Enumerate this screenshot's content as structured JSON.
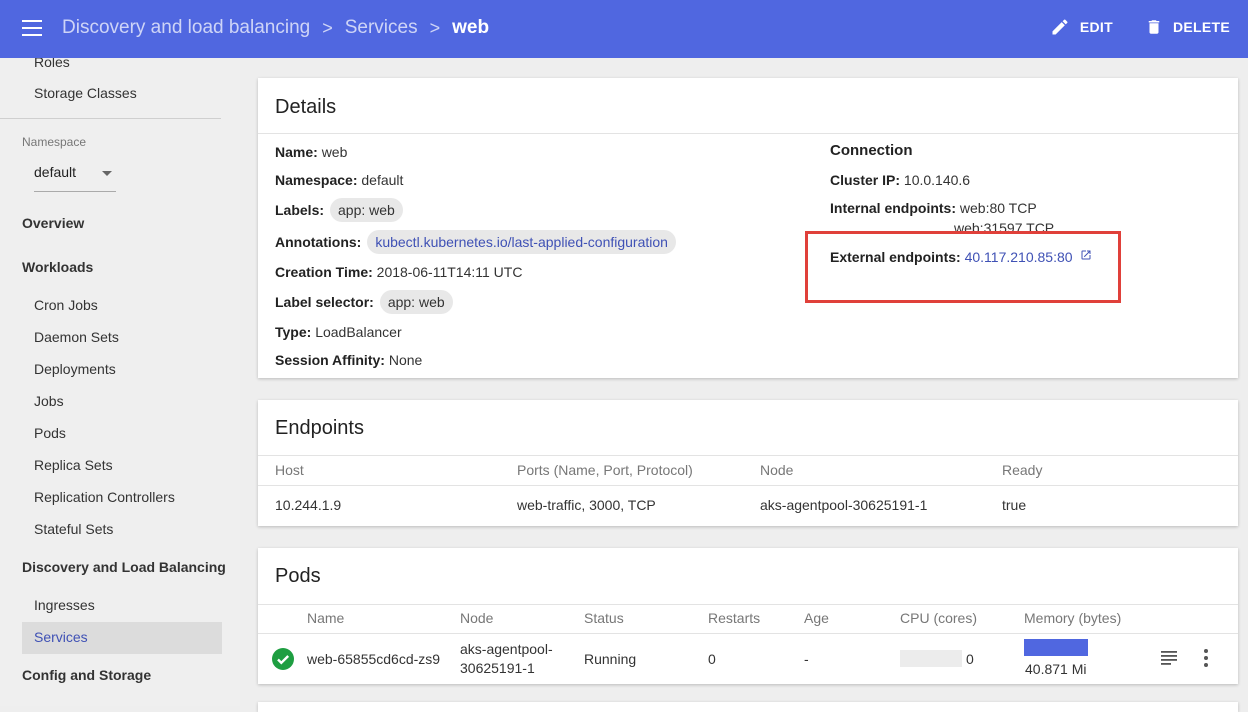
{
  "header": {
    "breadcrumb": [
      "Discovery and load balancing",
      "Services",
      "web"
    ],
    "edit_label": "EDIT",
    "delete_label": "DELETE"
  },
  "sidebar": {
    "top_items": [
      "Roles",
      "Storage Classes"
    ],
    "namespace_label": "Namespace",
    "namespace_value": "default",
    "overview": "Overview",
    "workloads": "Workloads",
    "workload_items": [
      "Cron Jobs",
      "Daemon Sets",
      "Deployments",
      "Jobs",
      "Pods",
      "Replica Sets",
      "Replication Controllers",
      "Stateful Sets"
    ],
    "discovery": "Discovery and Load Balancing",
    "discovery_items": [
      "Ingresses",
      "Services"
    ],
    "config": "Config and Storage",
    "active": "Services"
  },
  "details": {
    "title": "Details",
    "name_label": "Name:",
    "name": "web",
    "namespace_label": "Namespace:",
    "namespace": "default",
    "labels_label": "Labels:",
    "labels": "app: web",
    "annotations_label": "Annotations:",
    "annotations": "kubectl.kubernetes.io/last-applied-configuration",
    "creation_label": "Creation Time:",
    "creation": "2018-06-11T14:11 UTC",
    "selector_label": "Label selector:",
    "selector": "app: web",
    "type_label": "Type:",
    "type": "LoadBalancer",
    "affinity_label": "Session Affinity:",
    "affinity": "None",
    "connection": {
      "title": "Connection",
      "cluster_ip_label": "Cluster IP:",
      "cluster_ip": "10.0.140.6",
      "internal_label": "Internal endpoints:",
      "internal": [
        "web:80 TCP",
        "web:31597 TCP"
      ],
      "external_label": "External endpoints:",
      "external": "40.117.210.85:80"
    }
  },
  "endpoints": {
    "title": "Endpoints",
    "columns": [
      "Host",
      "Ports (Name, Port, Protocol)",
      "Node",
      "Ready"
    ],
    "rows": [
      [
        "10.244.1.9",
        "web-traffic, 3000, TCP",
        "aks-agentpool-30625191-1",
        "true"
      ]
    ]
  },
  "pods": {
    "title": "Pods",
    "columns": [
      "Name",
      "Node",
      "Status",
      "Restarts",
      "Age",
      "CPU (cores)",
      "Memory (bytes)"
    ],
    "rows": [
      {
        "name": "web-65855cd6cd-zs9",
        "node_line1": "aks-agentpool-",
        "node_line2": "30625191-1",
        "status": "Running",
        "restarts": "0",
        "age": "-",
        "cpu": "0",
        "memory": "40.871 Mi"
      }
    ]
  }
}
